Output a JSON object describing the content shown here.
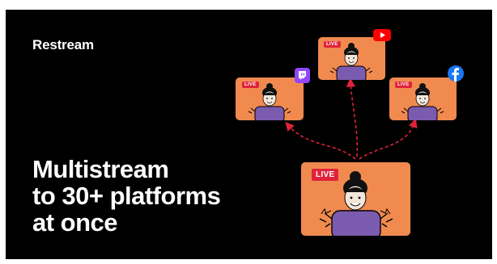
{
  "brand": {
    "name": "Restream"
  },
  "headline": {
    "line1": "Multistream",
    "line2": "to 30+ platforms",
    "line3": "at once"
  },
  "cards": {
    "main": {
      "badge": "LIVE"
    },
    "twitch": {
      "badge": "LIVE",
      "icon": "twitch-icon"
    },
    "youtube": {
      "badge": "LIVE",
      "icon": "youtube-icon"
    },
    "facebook": {
      "badge": "LIVE",
      "icon": "facebook-icon"
    }
  },
  "colors": {
    "background": "#000000",
    "card": "#f08a4f",
    "live": "#e0233a",
    "shirt": "#7b5bb0",
    "arrow": "#e0233a",
    "twitch": "#9146ff",
    "youtube": "#ff0000",
    "facebook": "#1877f2"
  }
}
